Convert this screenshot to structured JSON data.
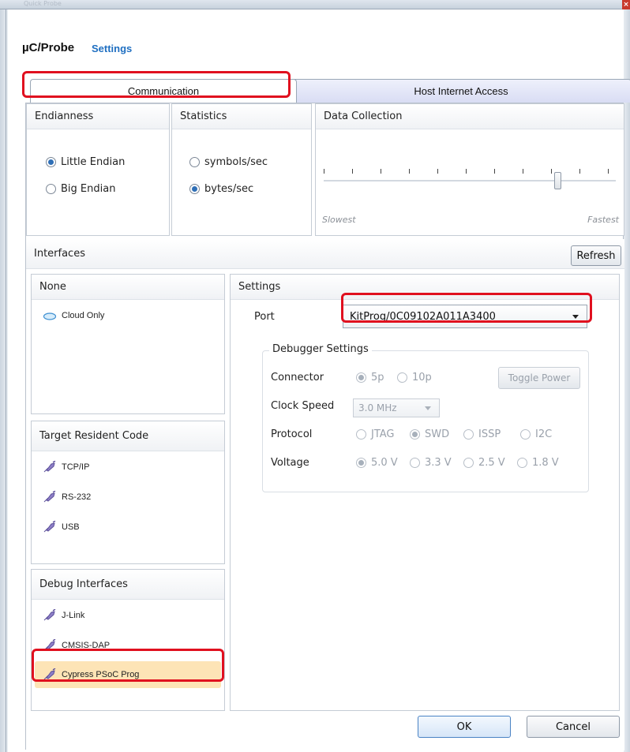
{
  "window": {
    "ghost_title": "Quick Probe",
    "close_glyph": "×"
  },
  "header": {
    "app_name": "µC/Probe",
    "subtitle": "Settings"
  },
  "tabs": [
    {
      "label": "Communication",
      "selected": true
    },
    {
      "label": "Host Internet Access",
      "selected": false
    }
  ],
  "endianness": {
    "title": "Endianness",
    "options": [
      {
        "label": "Little Endian",
        "checked": true
      },
      {
        "label": "Big Endian",
        "checked": false
      }
    ]
  },
  "statistics": {
    "title": "Statistics",
    "options": [
      {
        "label": "symbols/sec",
        "checked": false
      },
      {
        "label": "bytes/sec",
        "checked": true
      }
    ]
  },
  "data_collection": {
    "title": "Data Collection",
    "min_label": "Slowest",
    "max_label": "Fastest",
    "level_fraction": 0.8
  },
  "interfaces": {
    "title": "Interfaces",
    "refresh_label": "Refresh",
    "groups": [
      {
        "title": "None",
        "items": [
          {
            "label": "Cloud Only",
            "icon": "cloud-icon"
          }
        ]
      },
      {
        "title": "Target Resident Code",
        "items": [
          {
            "label": "TCP/IP",
            "icon": "plug-icon"
          },
          {
            "label": "RS-232",
            "icon": "plug-icon"
          },
          {
            "label": "USB",
            "icon": "plug-icon"
          }
        ]
      },
      {
        "title": "Debug Interfaces",
        "items": [
          {
            "label": "J-Link",
            "icon": "plug-icon"
          },
          {
            "label": "CMSIS-DAP",
            "icon": "plug-icon"
          },
          {
            "label": "Cypress PSoC Prog",
            "icon": "plug-icon",
            "selected": true
          }
        ]
      }
    ]
  },
  "settings": {
    "title": "Settings",
    "port_label": "Port",
    "port_value": "KitProg/0C09102A011A3400",
    "debugger": {
      "title": "Debugger Settings",
      "connector_label": "Connector",
      "connector_options": [
        "5p",
        "10p"
      ],
      "connector_selected": "5p",
      "toggle_power_label": "Toggle Power",
      "clock_label": "Clock Speed",
      "clock_value": "3.0 MHz",
      "protocol_label": "Protocol",
      "protocol_options": [
        "JTAG",
        "SWD",
        "ISSP",
        "I2C"
      ],
      "protocol_selected": "SWD",
      "voltage_label": "Voltage",
      "voltage_options": [
        "5.0 V",
        "3.3 V",
        "2.5 V",
        "1.8 V"
      ],
      "voltage_selected": "5.0 V"
    }
  },
  "footer": {
    "ok_label": "OK",
    "cancel_label": "Cancel"
  },
  "colors": {
    "accent": "#1f6fc1",
    "highlight": "#e0101f",
    "selected_item": "#fde4b6"
  }
}
